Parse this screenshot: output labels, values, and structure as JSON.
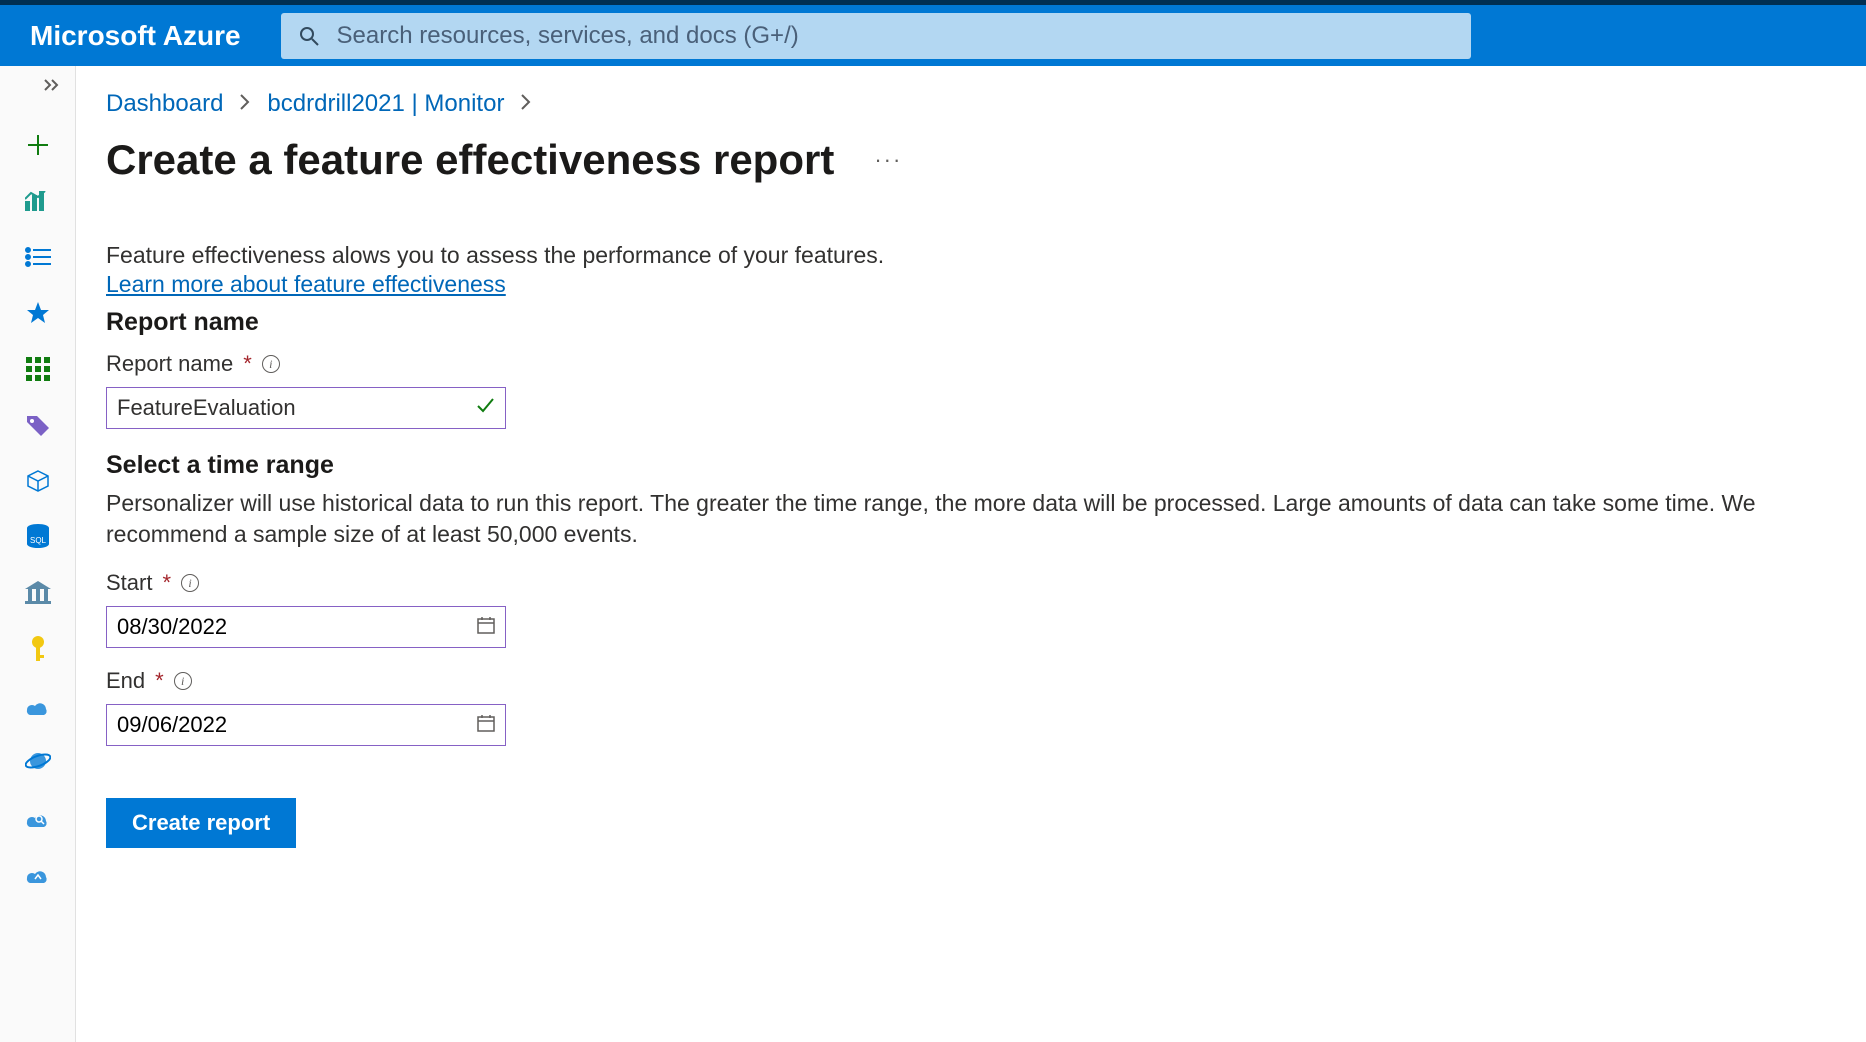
{
  "header": {
    "brand": "Microsoft Azure",
    "search_placeholder": "Search resources, services, and docs (G+/)"
  },
  "breadcrumb": {
    "items": [
      "Dashboard",
      "bcdrdrill2021 | Monitor"
    ]
  },
  "page": {
    "title": "Create a feature effectiveness report",
    "description": "Feature effectiveness alows you to assess the performance of your features.",
    "learn_link": "Learn more about feature effectiveness"
  },
  "report_name": {
    "section_label": "Report name",
    "field_label": "Report name",
    "value": "FeatureEvaluation"
  },
  "time_range": {
    "section_label": "Select a time range",
    "description": "Personalizer will use historical data to run this report. The greater the time range, the more data will be processed. Large amounts of data can take some time. We recommend a sample size of at least 50,000 events.",
    "start_label": "Start",
    "start_value": "08/30/2022",
    "end_label": "End",
    "end_value": "09/06/2022"
  },
  "actions": {
    "create_label": "Create report"
  },
  "sidebar": {
    "icons": [
      "create-resource-icon",
      "dashboard-icon",
      "all-services-icon",
      "favorites-icon",
      "app-grid-icon",
      "tags-icon",
      "cube-icon",
      "sql-icon",
      "bank-icon",
      "key-icon",
      "cloud-app-icon",
      "planet-icon",
      "cloud-search-icon",
      "cloud-deploy-icon"
    ]
  }
}
